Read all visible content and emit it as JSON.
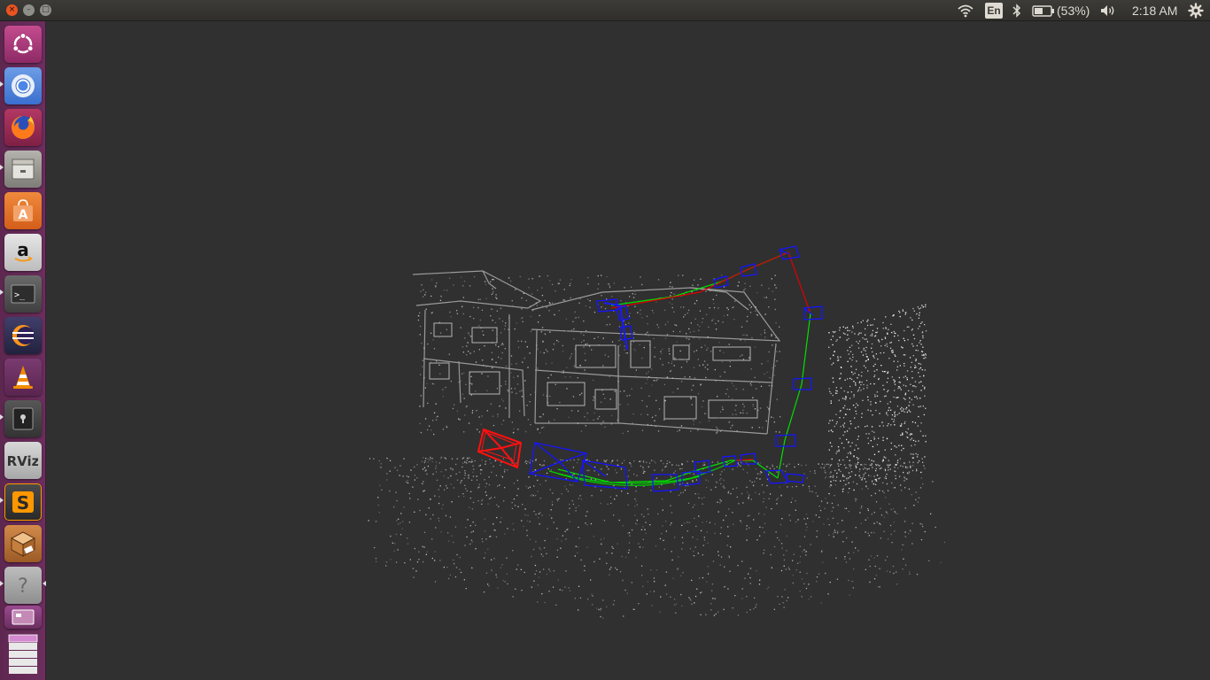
{
  "top_panel": {
    "window_controls": {
      "close_glyph": "×",
      "minimize_glyph": "–",
      "maximize_glyph": "□"
    },
    "indicators": {
      "wifi_icon": "wifi-icon",
      "keyboard_layout": "En",
      "bluetooth_icon": "bluetooth-icon",
      "battery_percent": "(53%)",
      "battery_level": 0.53,
      "sound_icon": "speaker-icon",
      "clock": "2:18 AM",
      "system_menu_icon": "gear-icon"
    }
  },
  "launcher": {
    "items": [
      {
        "name": "ubuntu-dash",
        "icon": "ubuntu-logo-icon",
        "running": false
      },
      {
        "name": "chromium",
        "icon": "chromium-icon",
        "running": true
      },
      {
        "name": "firefox",
        "icon": "firefox-icon",
        "running": false
      },
      {
        "name": "files",
        "icon": "file-cabinet-icon",
        "running": true
      },
      {
        "name": "software-center",
        "icon": "shopping-bag-icon",
        "glyph": "A",
        "running": false
      },
      {
        "name": "amazon",
        "icon": "amazon-icon",
        "glyph": "a",
        "running": false
      },
      {
        "name": "terminal",
        "icon": "terminal-icon",
        "glyph": ">_",
        "running": true
      },
      {
        "name": "eclipse",
        "icon": "eclipse-icon",
        "running": false
      },
      {
        "name": "vlc",
        "icon": "traffic-cone-icon",
        "running": false
      },
      {
        "name": "vault",
        "icon": "safe-icon",
        "running": true
      },
      {
        "name": "rviz",
        "icon": "rviz-icon",
        "glyph": "RViz",
        "running": false
      },
      {
        "name": "sublime-text",
        "icon": "sublime-icon",
        "glyph": "S",
        "running": true
      },
      {
        "name": "package-box",
        "icon": "box-icon",
        "running": false
      },
      {
        "name": "help",
        "icon": "question-icon",
        "glyph": "?",
        "running": true,
        "focused": true
      },
      {
        "name": "workspace-switcher",
        "icon": "workspaces-icon",
        "running": false
      },
      {
        "name": "trash",
        "icon": "stacked-windows-icon",
        "running": false
      }
    ]
  },
  "viewer": {
    "scene": "3d-point-cloud-with-camera-trajectory",
    "colors": {
      "background": "#303030",
      "points": "#bdbdbd",
      "keyframes": "#0000ff",
      "current_frame": "#ff0000",
      "trajectory_covisibility": "#00ff00",
      "trajectory_loop": "#ff0000"
    }
  }
}
